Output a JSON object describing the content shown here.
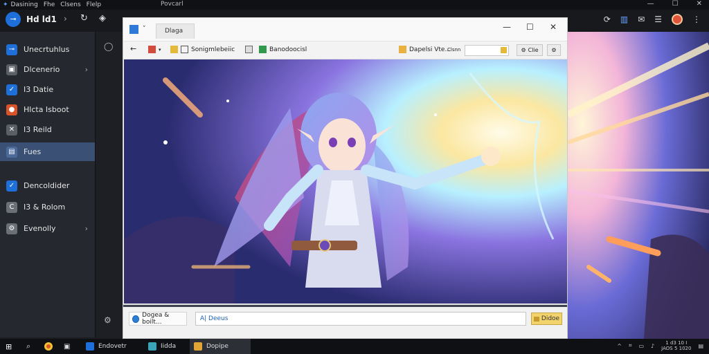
{
  "menubar": {
    "items": [
      "Dasining",
      "Fhe",
      "Clsens",
      "Flelp"
    ],
    "second_title": "Povcarl"
  },
  "header": {
    "title": "Hd ld1"
  },
  "sidebar": {
    "items": [
      {
        "label": "Unecrtuhlus",
        "icon": "app-icon",
        "color": "#1e6fd9",
        "chevron": false
      },
      {
        "label": "Dlcenerio",
        "icon": "window-icon",
        "color": "#5a5e66",
        "chevron": true
      },
      {
        "label": "I3 Datie",
        "icon": "check-icon",
        "color": "#1e6fd9",
        "chevron": false
      },
      {
        "label": "Hlcta Isboot",
        "icon": "chrome-icon",
        "color": "#d9532a",
        "chevron": false
      },
      {
        "label": "I3 Reild",
        "icon": "close-icon",
        "color": "#5a5e66",
        "chevron": false
      },
      {
        "label": "Fues",
        "icon": "folder-icon",
        "color": "#4b6a99",
        "chevron": false
      },
      {
        "label": "Dencoldider",
        "icon": "check-icon",
        "color": "#1e6fd9",
        "chevron": false
      },
      {
        "label": "I3 & Rolom",
        "icon": "circle-c-icon",
        "color": "#6b6f78",
        "chevron": false
      },
      {
        "label": "Evenolly",
        "icon": "settings-icon",
        "color": "#6b6f78",
        "chevron": true
      }
    ],
    "active_index": 5
  },
  "window": {
    "tab_label": "Dlaga",
    "toolbar": {
      "item1": "Sonigmlebeiic",
      "item2": "Banodoocisl",
      "item3": "Dapelsi Vte...",
      "input_label": "Clsnn",
      "button": "Clie"
    },
    "bottom": {
      "left_label": "Dogea & boilt...",
      "input_value": "A| Deeus",
      "button": "Didoe"
    }
  },
  "taskbar": {
    "apps": [
      "Endovetr",
      "Iidda",
      "Dopipe"
    ],
    "time": "1 d3 10 I",
    "date": "JAOS 5 1020"
  }
}
